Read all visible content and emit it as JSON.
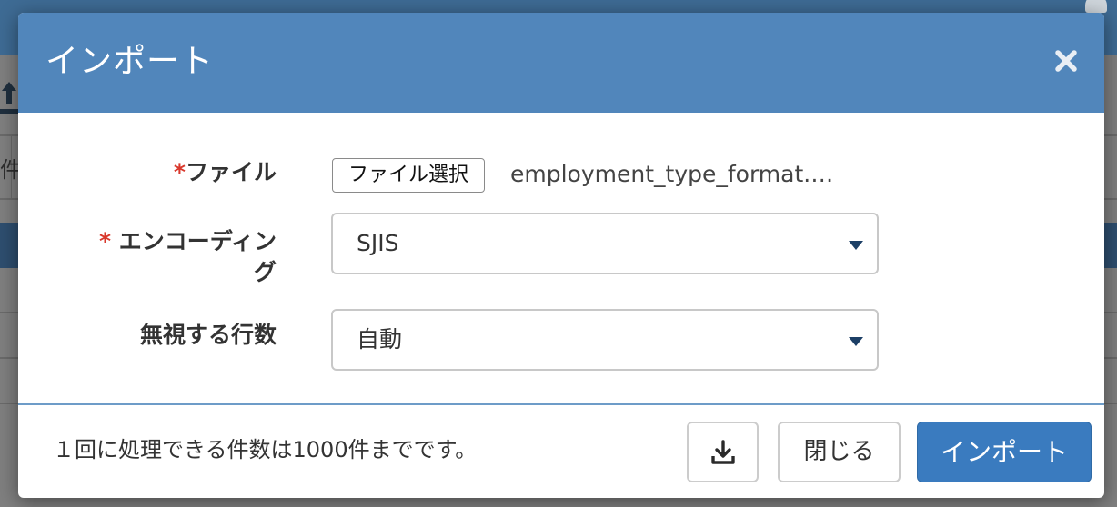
{
  "background": {
    "fragment_text": "件"
  },
  "modal": {
    "title": "インポート",
    "close_icon": "close-icon",
    "form": {
      "file": {
        "required_mark": "*",
        "label": "ファイル",
        "button_label": "ファイル選択",
        "selected_file": "employment_type_format.…"
      },
      "encoding": {
        "required_mark": "*",
        "label": " エンコーディング",
        "value": "SJIS",
        "arrow_icon": "caret-down-icon"
      },
      "skip_rows": {
        "label": "無視する行数",
        "value": "自動",
        "arrow_icon": "caret-down-icon"
      }
    },
    "footer": {
      "note": "１回に処理できる件数は1000件までです。",
      "download_icon": "download-icon",
      "close_label": "閉じる",
      "import_label": "インポート"
    }
  },
  "colors": {
    "header": "#5186bb",
    "primary_button": "#3a7bbf",
    "required": "#d9382c"
  }
}
